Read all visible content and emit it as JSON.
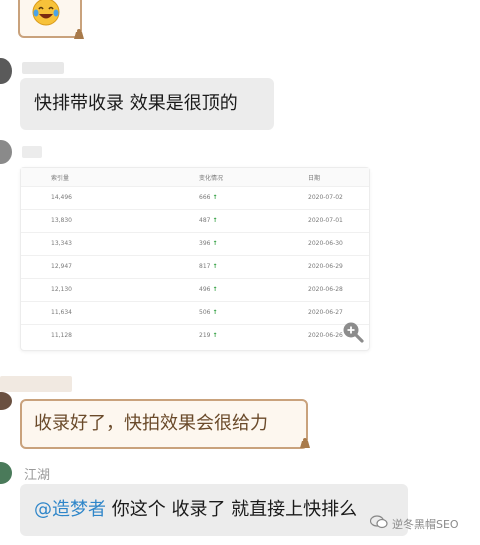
{
  "messages": {
    "m1": {
      "emoji_icon": "laughing-tears-emoji"
    },
    "m2": {
      "text": "快排带收录 效果是很顶的"
    },
    "m4": {
      "text": "收录好了，快拍效果会很给力"
    },
    "m5": {
      "sender": "江湖",
      "mention": "@造梦者",
      "text": " 你这个 收录了 就直接上快排么"
    }
  },
  "table": {
    "headers": [
      "索引量",
      "变化情况",
      "日期"
    ],
    "rows": [
      [
        "14,496",
        "666",
        "2020-07-02"
      ],
      [
        "13,830",
        "487",
        "2020-07-01"
      ],
      [
        "13,343",
        "396",
        "2020-06-30"
      ],
      [
        "12,947",
        "817",
        "2020-06-29"
      ],
      [
        "12,130",
        "496",
        "2020-06-28"
      ],
      [
        "11,634",
        "506",
        "2020-06-27"
      ],
      [
        "11,128",
        "219",
        "2020-06-26"
      ]
    ],
    "arrow": "↑",
    "zoom_icon": "zoom-in-icon"
  },
  "watermark": {
    "text": "逆冬黑帽SEO",
    "icon": "wechat-icon"
  },
  "colors": {
    "bubble_gray": "#ececec",
    "bubble_border": "#c9a27c",
    "mention": "#2f86c9",
    "arrow_green": "#2e9e3e"
  }
}
